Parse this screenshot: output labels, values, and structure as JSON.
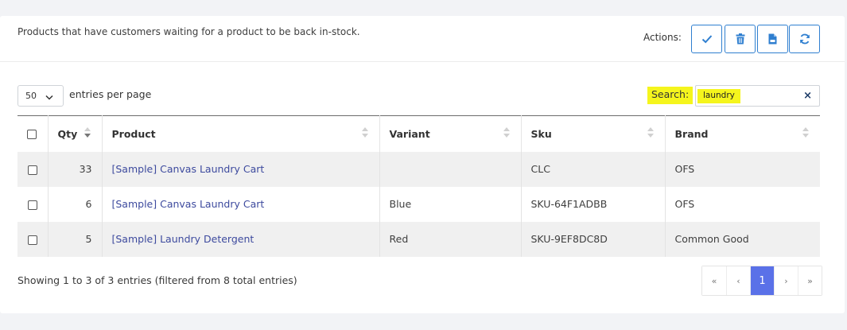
{
  "header": {
    "description": "Products that have customers waiting for a product to be back in-stock.",
    "actions_label": "Actions:",
    "actions": [
      {
        "name": "check-icon"
      },
      {
        "name": "trash-icon"
      },
      {
        "name": "file-icon"
      },
      {
        "name": "refresh-icon"
      }
    ]
  },
  "controls": {
    "page_length": "50",
    "page_length_label": "entries per page",
    "search_label": "Search:",
    "search_value": "laundry",
    "clear_symbol": "×"
  },
  "table": {
    "columns": [
      "Qty",
      "Product",
      "Variant",
      "Sku",
      "Brand"
    ],
    "rows": [
      {
        "qty": "33",
        "product": "[Sample] Canvas Laundry Cart",
        "variant": "",
        "sku": "CLC",
        "brand": "OFS"
      },
      {
        "qty": "6",
        "product": "[Sample] Canvas Laundry Cart",
        "variant": "Blue",
        "sku": "SKU-64F1ADBB",
        "brand": "OFS"
      },
      {
        "qty": "5",
        "product": "[Sample] Laundry Detergent",
        "variant": "Red",
        "sku": "SKU-9EF8DC8D",
        "brand": "Common Good"
      }
    ]
  },
  "footer": {
    "info": "Showing 1 to 3 of 3 entries (filtered from 8 total entries)",
    "pager": {
      "first": "«",
      "prev": "‹",
      "current": "1",
      "next": "›",
      "last": "»"
    }
  },
  "colors": {
    "accent": "#5a71e8",
    "action_border": "#2f7fd0",
    "highlight": "#f5f51d",
    "link": "#3d4a9e"
  }
}
